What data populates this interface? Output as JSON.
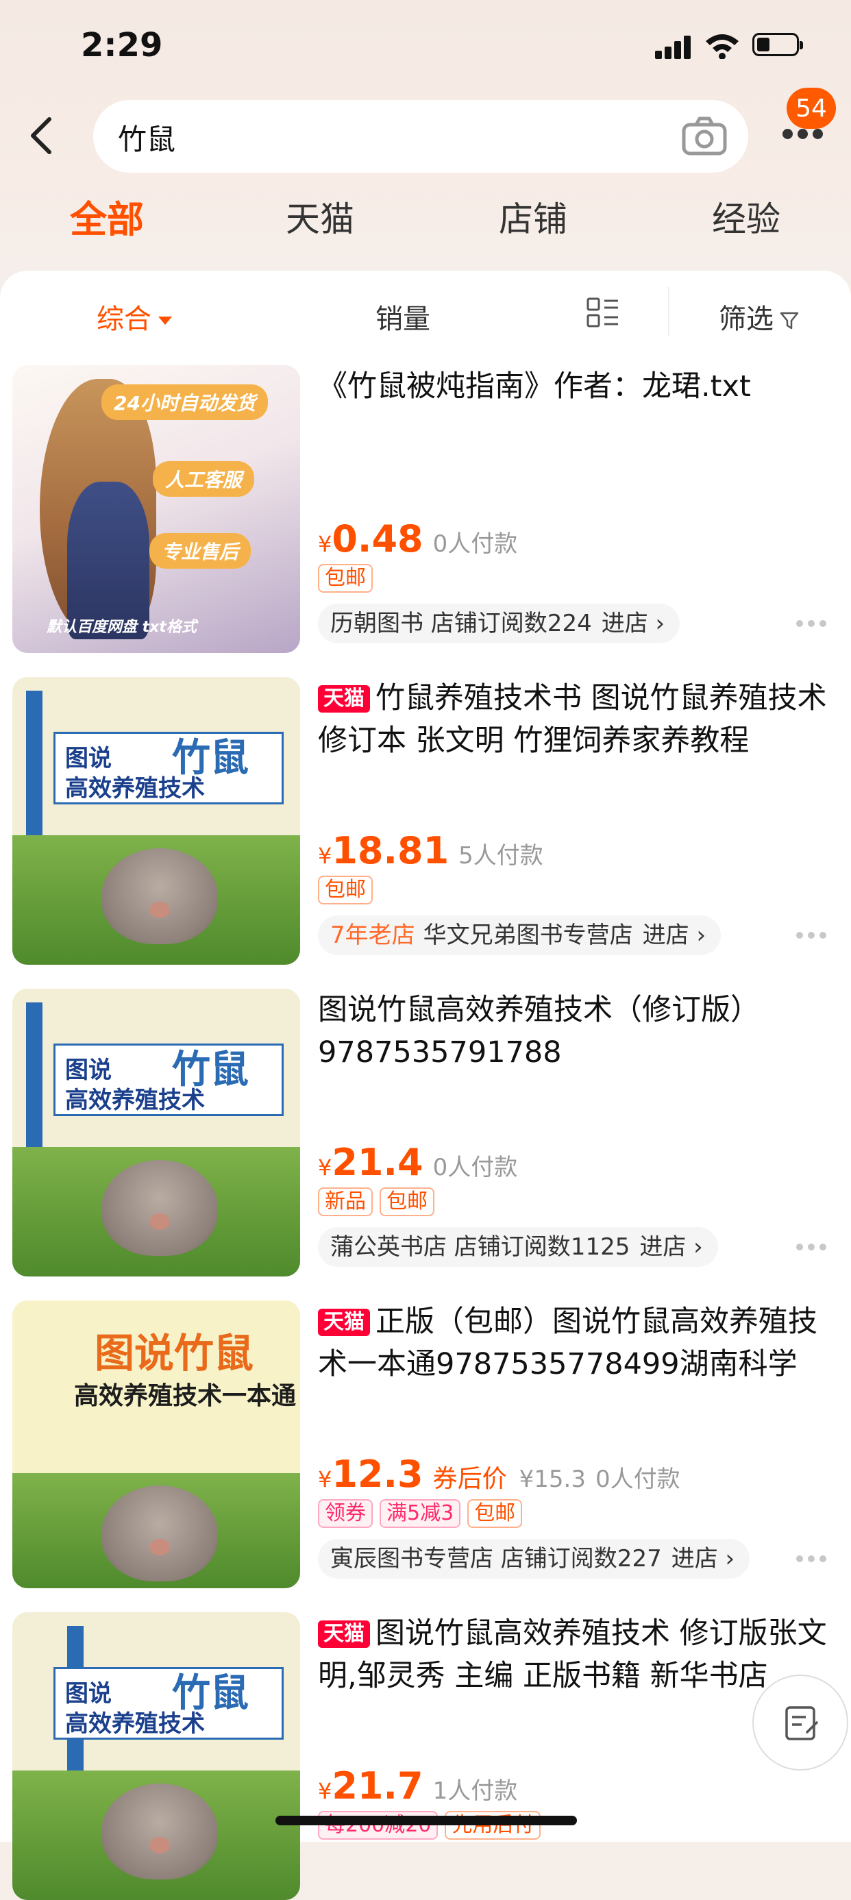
{
  "status_bar": {
    "time": "2:29"
  },
  "search": {
    "query": "竹鼠",
    "notification_count": "54"
  },
  "tabs": [
    {
      "label": "全部",
      "active": true
    },
    {
      "label": "天猫",
      "active": false
    },
    {
      "label": "店铺",
      "active": false
    },
    {
      "label": "经验",
      "active": false
    }
  ],
  "sort": {
    "comprehensive": "综合",
    "sales": "销量",
    "filter": "筛选"
  },
  "items": [
    {
      "badge": "",
      "title": "《竹鼠被炖指南》作者：龙珺.txt",
      "currency": "¥",
      "price": "0.48",
      "coupon_label": "",
      "old_price": "",
      "sales": "0人付款",
      "tags": [
        "包邮"
      ],
      "shop_prefix": "",
      "shop": "历朝图书 店铺订阅数224",
      "enter": "进店",
      "cover": {
        "bubbles": [
          "24小时自动发货",
          "人工客服",
          "专业售后"
        ],
        "footer": "默认百度网盘 txt格式"
      }
    },
    {
      "badge": "天猫",
      "title": "竹鼠养殖技术书 图说竹鼠养殖技术 修订本 张文明 竹狸饲养家养教程",
      "currency": "¥",
      "price": "18.81",
      "coupon_label": "",
      "old_price": "",
      "sales": "5人付款",
      "tags": [
        "包邮"
      ],
      "shop_prefix": "7年老店",
      "shop": "华文兄弟图书专营店",
      "enter": "进店",
      "cover": {
        "line1": "图说",
        "big": "竹鼠",
        "line2": "高效养殖技术"
      }
    },
    {
      "badge": "",
      "title": "图说竹鼠高效养殖技术（修订版）9787535791788",
      "currency": "¥",
      "price": "21.4",
      "coupon_label": "",
      "old_price": "",
      "sales": "0人付款",
      "tags": [
        "新品",
        "包邮"
      ],
      "shop_prefix": "",
      "shop": "蒲公英书店 店铺订阅数1125",
      "enter": "进店",
      "cover": {
        "line1": "图说",
        "big": "竹鼠",
        "line2": "高效养殖技术"
      }
    },
    {
      "badge": "天猫",
      "title": "正版（包邮）图说竹鼠高效养殖技术一本通9787535778499湖南科学",
      "currency": "¥",
      "price": "12.3",
      "coupon_label": "券后价",
      "old_price": "¥15.3",
      "sales": "0人付款",
      "tags_pink": [
        "领券",
        "满5减3"
      ],
      "tags": [
        "包邮"
      ],
      "shop_prefix": "",
      "shop": "寅辰图书专营店 店铺订阅数227",
      "enter": "进店",
      "cover": {
        "line1": "图说竹鼠",
        "line2": "高效养殖技术一本通"
      }
    },
    {
      "badge": "天猫",
      "title": "图说竹鼠高效养殖技术 修订版张文明,邹灵秀 主编 正版书籍 新华书店",
      "currency": "¥",
      "price": "21.7",
      "coupon_label": "",
      "old_price": "",
      "sales": "1人付款",
      "tags_pink": [
        "每200减20"
      ],
      "tags": [
        "先用后付"
      ],
      "shop_prefix": "",
      "shop": "",
      "enter": "",
      "cover": {
        "line1": "图说",
        "big": "竹鼠",
        "line2": "高效养殖技术"
      }
    }
  ]
}
